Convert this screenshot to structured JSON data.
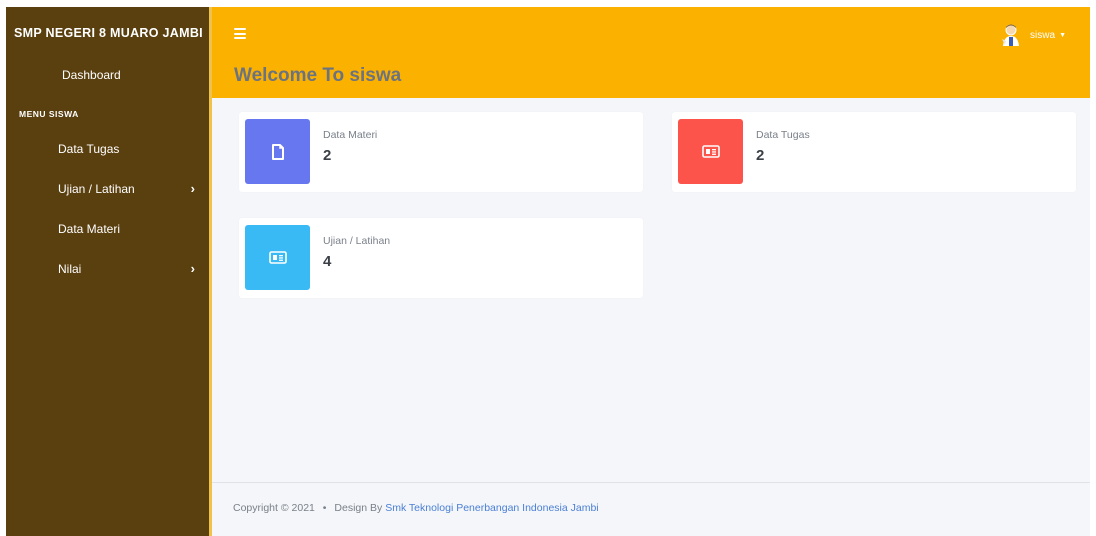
{
  "colors": {
    "sidebar_bg": "#5a3f0f",
    "topbar_bg": "#fbb100",
    "materi_icon_bg": "#6777ef",
    "tugas_icon_bg": "#fc544b",
    "ujian_icon_bg": "#3abaf4",
    "link": "#4a7fd6"
  },
  "sidebar": {
    "brand": "SMP NEGERI 8 MUARO JAMBI",
    "dashboard": "Dashboard",
    "heading": "MENU SISWA",
    "items": [
      {
        "label": "Data Tugas",
        "has_submenu": false
      },
      {
        "label": "Ujian / Latihan",
        "has_submenu": true
      },
      {
        "label": "Data Materi",
        "has_submenu": false
      },
      {
        "label": "Nilai",
        "has_submenu": true
      }
    ]
  },
  "topbar": {
    "menu_icon": "hamburger-icon",
    "user_name": "siswa",
    "welcome": "Welcome To siswa"
  },
  "cards": [
    {
      "label": "Data Materi",
      "value": "2",
      "icon": "file-icon"
    },
    {
      "label": "Data Tugas",
      "value": "2",
      "icon": "newspaper-icon"
    },
    {
      "label": "Ujian / Latihan",
      "value": "4",
      "icon": "newspaper-icon"
    }
  ],
  "footer": {
    "copyright": "Copyright © 2021",
    "dot": "•",
    "design_by": "Design By",
    "link": "Smk Teknologi Penerbangan Indonesia Jambi"
  }
}
